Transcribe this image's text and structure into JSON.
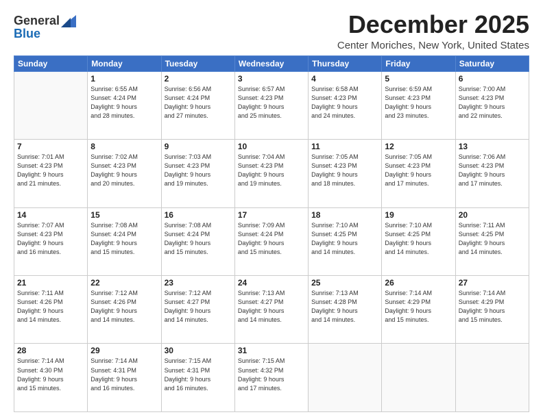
{
  "logo": {
    "general": "General",
    "blue": "Blue"
  },
  "header": {
    "month": "December 2025",
    "location": "Center Moriches, New York, United States"
  },
  "days_of_week": [
    "Sunday",
    "Monday",
    "Tuesday",
    "Wednesday",
    "Thursday",
    "Friday",
    "Saturday"
  ],
  "weeks": [
    [
      {
        "day": "",
        "info": ""
      },
      {
        "day": "1",
        "info": "Sunrise: 6:55 AM\nSunset: 4:24 PM\nDaylight: 9 hours\nand 28 minutes."
      },
      {
        "day": "2",
        "info": "Sunrise: 6:56 AM\nSunset: 4:24 PM\nDaylight: 9 hours\nand 27 minutes."
      },
      {
        "day": "3",
        "info": "Sunrise: 6:57 AM\nSunset: 4:23 PM\nDaylight: 9 hours\nand 25 minutes."
      },
      {
        "day": "4",
        "info": "Sunrise: 6:58 AM\nSunset: 4:23 PM\nDaylight: 9 hours\nand 24 minutes."
      },
      {
        "day": "5",
        "info": "Sunrise: 6:59 AM\nSunset: 4:23 PM\nDaylight: 9 hours\nand 23 minutes."
      },
      {
        "day": "6",
        "info": "Sunrise: 7:00 AM\nSunset: 4:23 PM\nDaylight: 9 hours\nand 22 minutes."
      }
    ],
    [
      {
        "day": "7",
        "info": "Sunrise: 7:01 AM\nSunset: 4:23 PM\nDaylight: 9 hours\nand 21 minutes."
      },
      {
        "day": "8",
        "info": "Sunrise: 7:02 AM\nSunset: 4:23 PM\nDaylight: 9 hours\nand 20 minutes."
      },
      {
        "day": "9",
        "info": "Sunrise: 7:03 AM\nSunset: 4:23 PM\nDaylight: 9 hours\nand 19 minutes."
      },
      {
        "day": "10",
        "info": "Sunrise: 7:04 AM\nSunset: 4:23 PM\nDaylight: 9 hours\nand 19 minutes."
      },
      {
        "day": "11",
        "info": "Sunrise: 7:05 AM\nSunset: 4:23 PM\nDaylight: 9 hours\nand 18 minutes."
      },
      {
        "day": "12",
        "info": "Sunrise: 7:05 AM\nSunset: 4:23 PM\nDaylight: 9 hours\nand 17 minutes."
      },
      {
        "day": "13",
        "info": "Sunrise: 7:06 AM\nSunset: 4:23 PM\nDaylight: 9 hours\nand 17 minutes."
      }
    ],
    [
      {
        "day": "14",
        "info": "Sunrise: 7:07 AM\nSunset: 4:23 PM\nDaylight: 9 hours\nand 16 minutes."
      },
      {
        "day": "15",
        "info": "Sunrise: 7:08 AM\nSunset: 4:24 PM\nDaylight: 9 hours\nand 15 minutes."
      },
      {
        "day": "16",
        "info": "Sunrise: 7:08 AM\nSunset: 4:24 PM\nDaylight: 9 hours\nand 15 minutes."
      },
      {
        "day": "17",
        "info": "Sunrise: 7:09 AM\nSunset: 4:24 PM\nDaylight: 9 hours\nand 15 minutes."
      },
      {
        "day": "18",
        "info": "Sunrise: 7:10 AM\nSunset: 4:25 PM\nDaylight: 9 hours\nand 14 minutes."
      },
      {
        "day": "19",
        "info": "Sunrise: 7:10 AM\nSunset: 4:25 PM\nDaylight: 9 hours\nand 14 minutes."
      },
      {
        "day": "20",
        "info": "Sunrise: 7:11 AM\nSunset: 4:25 PM\nDaylight: 9 hours\nand 14 minutes."
      }
    ],
    [
      {
        "day": "21",
        "info": "Sunrise: 7:11 AM\nSunset: 4:26 PM\nDaylight: 9 hours\nand 14 minutes."
      },
      {
        "day": "22",
        "info": "Sunrise: 7:12 AM\nSunset: 4:26 PM\nDaylight: 9 hours\nand 14 minutes."
      },
      {
        "day": "23",
        "info": "Sunrise: 7:12 AM\nSunset: 4:27 PM\nDaylight: 9 hours\nand 14 minutes."
      },
      {
        "day": "24",
        "info": "Sunrise: 7:13 AM\nSunset: 4:27 PM\nDaylight: 9 hours\nand 14 minutes."
      },
      {
        "day": "25",
        "info": "Sunrise: 7:13 AM\nSunset: 4:28 PM\nDaylight: 9 hours\nand 14 minutes."
      },
      {
        "day": "26",
        "info": "Sunrise: 7:14 AM\nSunset: 4:29 PM\nDaylight: 9 hours\nand 15 minutes."
      },
      {
        "day": "27",
        "info": "Sunrise: 7:14 AM\nSunset: 4:29 PM\nDaylight: 9 hours\nand 15 minutes."
      }
    ],
    [
      {
        "day": "28",
        "info": "Sunrise: 7:14 AM\nSunset: 4:30 PM\nDaylight: 9 hours\nand 15 minutes."
      },
      {
        "day": "29",
        "info": "Sunrise: 7:14 AM\nSunset: 4:31 PM\nDaylight: 9 hours\nand 16 minutes."
      },
      {
        "day": "30",
        "info": "Sunrise: 7:15 AM\nSunset: 4:31 PM\nDaylight: 9 hours\nand 16 minutes."
      },
      {
        "day": "31",
        "info": "Sunrise: 7:15 AM\nSunset: 4:32 PM\nDaylight: 9 hours\nand 17 minutes."
      },
      {
        "day": "",
        "info": ""
      },
      {
        "day": "",
        "info": ""
      },
      {
        "day": "",
        "info": ""
      }
    ]
  ]
}
